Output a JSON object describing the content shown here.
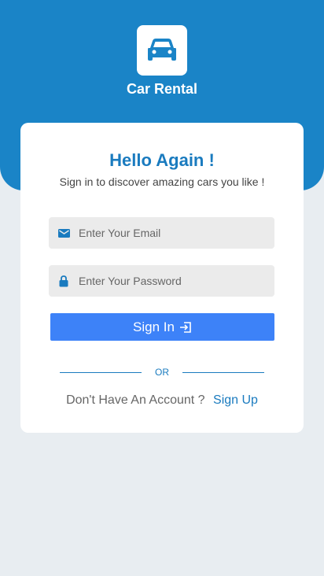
{
  "app": {
    "title": "Car Rental",
    "logo_icon": "car-icon"
  },
  "colors": {
    "primary": "#1a84c7",
    "button": "#3d82f8",
    "background": "#e8edf1"
  },
  "card": {
    "heading": "Hello Again !",
    "subtitle": "Sign in to discover amazing cars you like !"
  },
  "form": {
    "email": {
      "placeholder": "Enter Your Email",
      "value": "",
      "icon": "mail-icon"
    },
    "password": {
      "placeholder": "Enter Your Password",
      "value": "",
      "icon": "lock-icon"
    },
    "signin_label": "Sign In",
    "signin_icon": "login-icon"
  },
  "divider": {
    "label": "OR"
  },
  "signup": {
    "question": "Don't Have An Account ?",
    "link_label": "Sign Up"
  }
}
